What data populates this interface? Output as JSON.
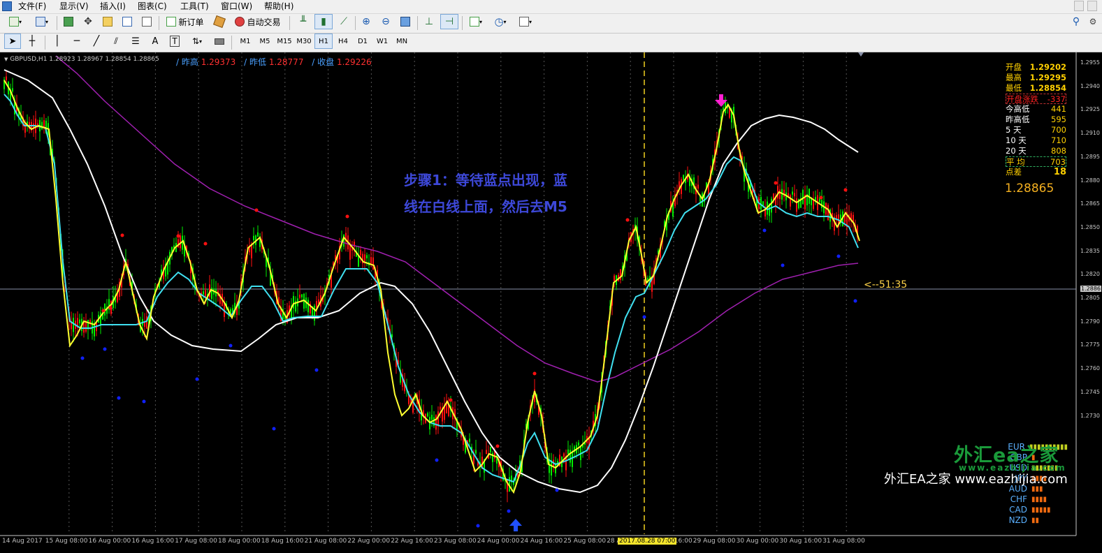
{
  "menu": [
    "文件(F)",
    "显示(V)",
    "插入(I)",
    "图表(C)",
    "工具(T)",
    "窗口(W)",
    "帮助(H)"
  ],
  "toolbar": {
    "new_order": "新订单",
    "auto_trade": "自动交易"
  },
  "timeframes": [
    "M1",
    "M5",
    "M15",
    "M30",
    "H1",
    "H4",
    "D1",
    "W1",
    "MN"
  ],
  "active_timeframe": "H1",
  "chart": {
    "symbol_info": "GBPUSD,H1  1.28923 1.28967 1.28854 1.28865",
    "prev": {
      "high_label": "/ 昨高",
      "high": "1.29373",
      "low_label": "/ 昨低",
      "low": "1.28777",
      "close_label": "/ 收盘",
      "close": "1.29226"
    },
    "annotation": [
      "步骤1：等待蓝点出现，蓝",
      "线在白线上面，然后去M5"
    ],
    "panel": {
      "open_label": "开盘",
      "open": "1.29202",
      "high_label": "最高",
      "high": "1.29295",
      "low_label": "最低",
      "low": "1.28854",
      "change_label": "开盘涨跌",
      "change": "-337",
      "ranges": [
        {
          "label": "今高低",
          "value": "441"
        },
        {
          "label": "昨高低",
          "value": "595"
        },
        {
          "label": "5   天",
          "value": "700"
        },
        {
          "label": "10  天",
          "value": "710"
        },
        {
          "label": "20  天",
          "value": "808"
        }
      ],
      "avg_label": "平   均",
      "avg": "703",
      "spread_label": "点差",
      "spread": "18",
      "current_price": "1.28865"
    },
    "countdown": "<--51:35",
    "strength": [
      {
        "cur": "EUR",
        "bars": "▮▮▮▮▮▮▮▮▮▮"
      },
      {
        "cur": "GBP",
        "bars": "▮"
      },
      {
        "cur": "USD",
        "bars": "▮▮▮▮▮▮▮"
      },
      {
        "cur": "JPY",
        "bars": "▮▮▮▮"
      },
      {
        "cur": "AUD",
        "bars": "▮▮▮"
      },
      {
        "cur": "CHF",
        "bars": "▮▮▮▮"
      },
      {
        "cur": "CAD",
        "bars": "▮▮▮▮▮"
      },
      {
        "cur": "NZD",
        "bars": "▮▮"
      }
    ],
    "price_labels": [
      "1.2955",
      "1.2940",
      "1.2925",
      "1.2910",
      "1.2895",
      "1.2880",
      "1.2865",
      "1.2850",
      "1.2835",
      "1.2820",
      "1.2805",
      "1.2790",
      "1.2775",
      "1.2760",
      "1.2745",
      "1.2730"
    ],
    "current_price_tag": "1.2886",
    "time_labels": [
      "14 Aug 2017",
      "15 Aug 08:00",
      "16 Aug 00:00",
      "16 Aug 16:00",
      "17 Aug 08:00",
      "18 Aug 00:00",
      "18 Aug 16:00",
      "21 Aug 08:00",
      "22 Aug 00:00",
      "22 Aug 16:00",
      "23 Aug 08:00",
      "24 Aug 00:00",
      "24 Aug 16:00",
      "25 Aug 08:00",
      "28 Aug 00:00",
      "28 Aug 16:00",
      "29 Aug 08:00",
      "30 Aug 00:00",
      "30 Aug 16:00",
      "31 Aug 08:00"
    ],
    "highlight_time": "2017.08.28 07:00",
    "colors": {
      "up": "#00ee00",
      "down": "#ff1010",
      "fast_ma": "#ffff30",
      "mid_ma": "#40e0f0",
      "slow_ma": "#ffffff",
      "long_ma": "#a020b0",
      "dots_red": "#ff1010",
      "dots_blue": "#1020ff",
      "arrow_up": "#2050ff",
      "arrow_down": "#ff20d0"
    }
  },
  "watermark": {
    "main": "外汇ea之家",
    "url": "www.eazhijia.com",
    "site": "外汇EA之家 www.eazhijia.com"
  }
}
